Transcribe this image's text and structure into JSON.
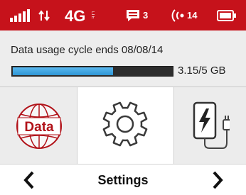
{
  "status_bar": {
    "network_type": "4G",
    "network_sub": "LTE",
    "message_count": "3",
    "wifi_clients": "14",
    "bg_color": "#c6121b",
    "icons": [
      "signal-icon",
      "data-arrows-icon",
      "4g-lte-icon",
      "message-icon",
      "wifi-broadcast-icon",
      "battery-icon"
    ]
  },
  "usage": {
    "cycle_text": "Data usage cycle ends 08/08/14",
    "used_gb": 3.15,
    "total_gb": 5,
    "amount_text": "3.15/5 GB",
    "bar_color": "#2e95d3"
  },
  "tiles": {
    "data_label": "Data",
    "accent_color": "#c6121b"
  },
  "nav": {
    "title": "Settings"
  }
}
